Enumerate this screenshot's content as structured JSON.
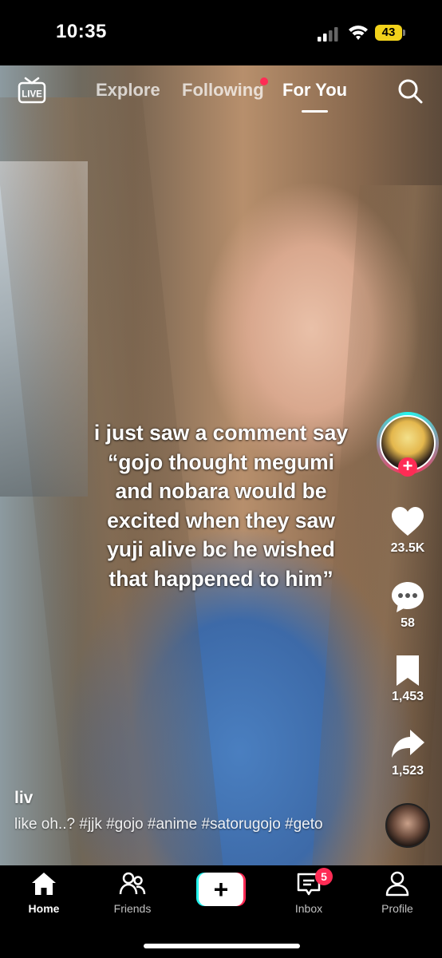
{
  "status_bar": {
    "time": "10:35",
    "battery": "43"
  },
  "top_nav": {
    "live_label": "LIVE",
    "tabs": [
      {
        "label": "Explore",
        "active": false
      },
      {
        "label": "Following",
        "active": false,
        "has_dot": true
      },
      {
        "label": "For You",
        "active": true
      }
    ]
  },
  "video": {
    "overlay_text": "i just saw a comment say\n“gojo thought megumi\nand nobara would be\nexcited when they saw\nyuji alive bc he wished\nthat happened to him”"
  },
  "actions": {
    "likes": "23.5K",
    "comments": "58",
    "saves": "1,453",
    "shares": "1,523"
  },
  "post": {
    "username": "liv",
    "description": "like oh..? #jjk #gojo #anime #satorugojo #geto"
  },
  "bottom_nav": {
    "items": [
      {
        "label": "Home",
        "icon": "home-icon",
        "active": true
      },
      {
        "label": "Friends",
        "icon": "friends-icon"
      },
      {
        "label": "",
        "icon": "plus-icon"
      },
      {
        "label": "Inbox",
        "icon": "inbox-icon",
        "badge": "5"
      },
      {
        "label": "Profile",
        "icon": "profile-icon"
      }
    ]
  },
  "colors": {
    "accent_red": "#fe2c55",
    "accent_cyan": "#25f4ee",
    "battery": "#f2d21b"
  }
}
